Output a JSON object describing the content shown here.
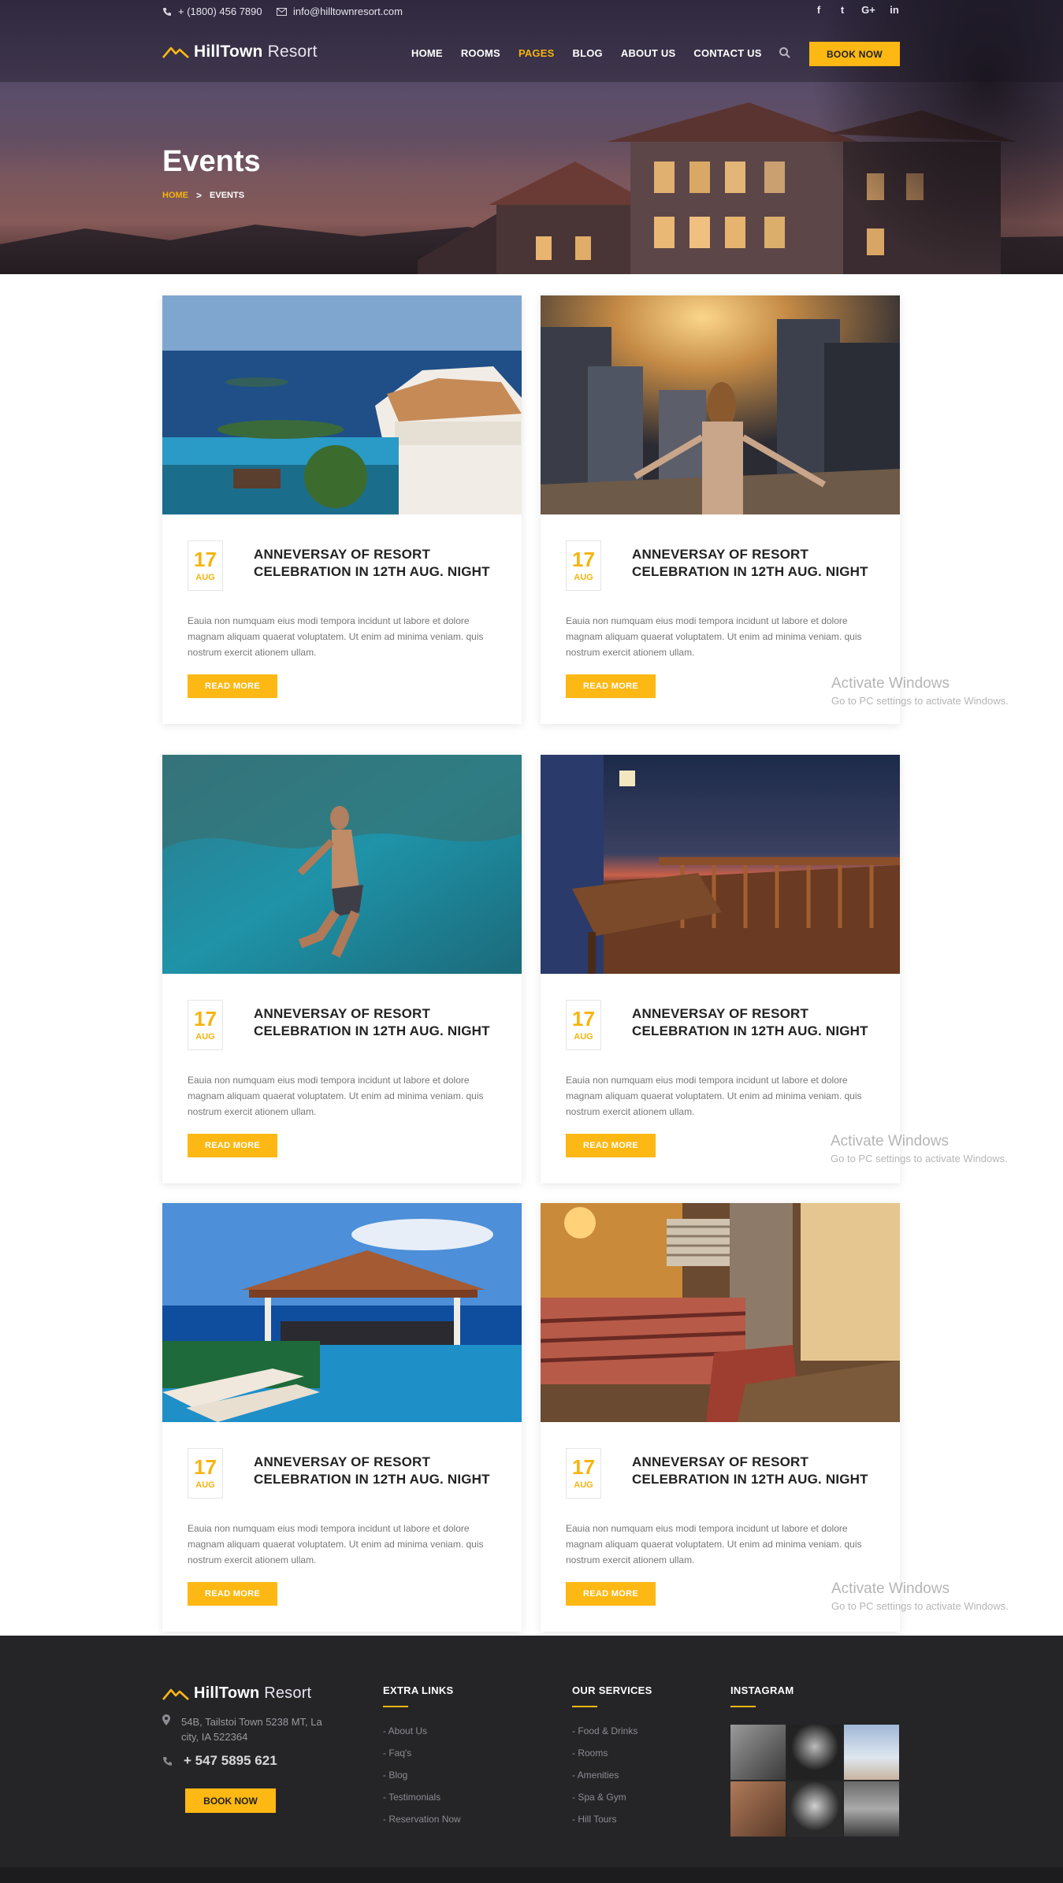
{
  "topbar": {
    "phone": "+ (1800) 456 7890",
    "email": "info@hilltownresort.com",
    "social": [
      "f",
      "t",
      "G+",
      "in"
    ],
    "social_icons": [
      "facebook-icon",
      "twitter-icon",
      "google-plus-icon",
      "linkedin-icon"
    ]
  },
  "brand": {
    "name_bold": "HillTown",
    "name_light": "Resort"
  },
  "nav": {
    "items": [
      "HOME",
      "ROOMS",
      "PAGES",
      "BLOG",
      "ABOUT US",
      "CONTACT US"
    ],
    "active": "PAGES",
    "book_label": "BOOK NOW"
  },
  "hero": {
    "title": "Events",
    "breadcrumb": {
      "home": "HOME",
      "separator": ">",
      "current": "EVENTS"
    }
  },
  "events": [
    {
      "day": "17",
      "month": "AUG",
      "title": "ANNEVERSAY OF RESORT CELEBRATION IN 12TH AUG. NIGHT",
      "text": "Eauia non numquam eius modi tempora incidunt ut labore et dolore magnam aliquam quaerat voluptatem. Ut enim ad minima veniam. quis nostrum exercit ationem ullam.",
      "button": "READ MORE"
    },
    {
      "day": "17",
      "month": "AUG",
      "title": "ANNEVERSAY OF RESORT CELEBRATION IN 12TH AUG. NIGHT",
      "text": "Eauia non numquam eius modi tempora incidunt ut labore et dolore magnam aliquam quaerat voluptatem. Ut enim ad minima veniam. quis nostrum exercit ationem ullam.",
      "button": "READ MORE"
    },
    {
      "day": "17",
      "month": "AUG",
      "title": "ANNEVERSAY OF RESORT CELEBRATION IN 12TH AUG. NIGHT",
      "text": "Eauia non numquam eius modi tempora incidunt ut labore et dolore magnam aliquam quaerat voluptatem. Ut enim ad minima veniam. quis nostrum exercit ationem ullam.",
      "button": "READ MORE"
    },
    {
      "day": "17",
      "month": "AUG",
      "title": "ANNEVERSAY OF RESORT CELEBRATION IN 12TH AUG. NIGHT",
      "text": "Eauia non numquam eius modi tempora incidunt ut labore et dolore magnam aliquam quaerat voluptatem. Ut enim ad minima veniam. quis nostrum exercit ationem ullam.",
      "button": "READ MORE"
    },
    {
      "day": "17",
      "month": "AUG",
      "title": "ANNEVERSAY OF RESORT CELEBRATION IN 12TH AUG. NIGHT",
      "text": "Eauia non numquam eius modi tempora incidunt ut labore et dolore magnam aliquam quaerat voluptatem. Ut enim ad minima veniam. quis nostrum exercit ationem ullam.",
      "button": "READ MORE"
    },
    {
      "day": "17",
      "month": "AUG",
      "title": "ANNEVERSAY OF RESORT CELEBRATION IN 12TH AUG. NIGHT",
      "text": "Eauia non numquam eius modi tempora incidunt ut labore et dolore magnam aliquam quaerat voluptatem. Ut enim ad minima veniam. quis nostrum exercit ationem ullam.",
      "button": "READ MORE"
    }
  ],
  "watermark": {
    "line1": "Activate Windows",
    "line2": "Go to PC settings to activate Windows."
  },
  "footer": {
    "address": "54B, Tailstoi Town 5238 MT, La city, IA 522364",
    "phone": "+ 547 5895 621",
    "book_label": "BOOK NOW",
    "extra_links": {
      "title": "EXTRA LINKS",
      "items": [
        "- About Us",
        "- Faq's",
        "- Blog",
        "- Testimonials",
        "- Reservation Now"
      ]
    },
    "services": {
      "title": "OUR SERVICES",
      "items": [
        "- Food & Drinks",
        "- Rooms",
        "- Amenities",
        "- Spa & Gym",
        "- Hill Tours"
      ]
    },
    "instagram": {
      "title": "INSTAGRAM"
    }
  },
  "colors": {
    "accent": "#fdb813",
    "footer_bg": "#252528",
    "text_dark": "#222222",
    "text_muted": "#777777"
  }
}
